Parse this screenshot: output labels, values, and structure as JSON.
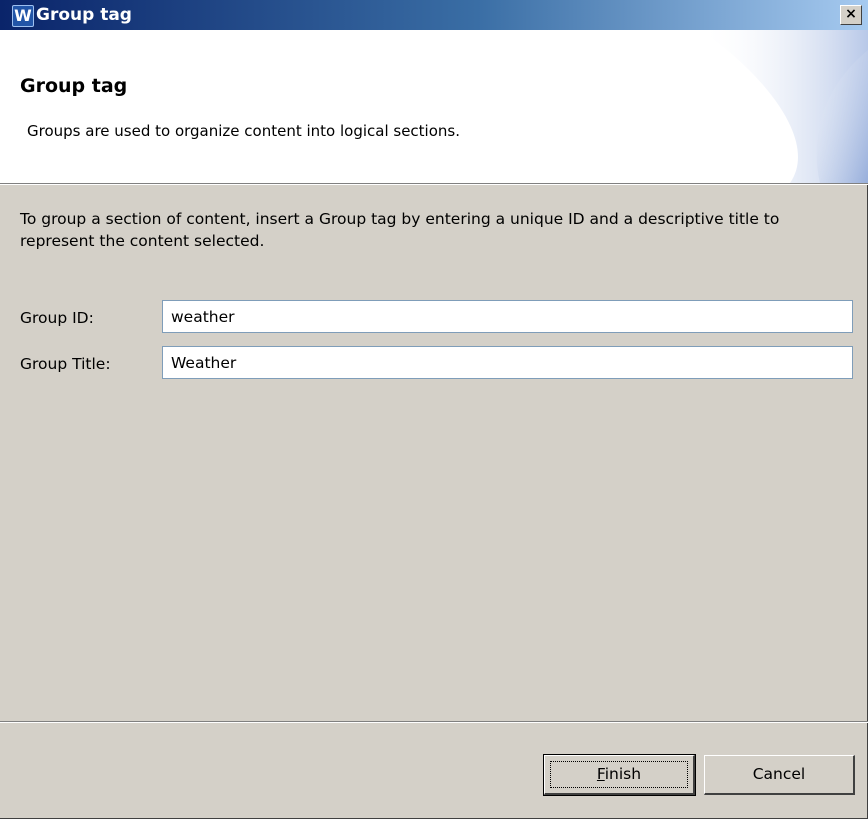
{
  "window": {
    "title": "Group tag",
    "app_icon_glyph": "W",
    "app_icon_name": "app-icon",
    "close_glyph": "×"
  },
  "header": {
    "title": "Group tag",
    "description": "Groups are used to organize content into logical sections."
  },
  "body": {
    "instructions": "To group a section of content, insert a Group tag by entering a unique ID and a descriptive title to represent the content selected.",
    "group_id": {
      "label": "Group ID:",
      "value": "weather"
    },
    "group_title": {
      "label": "Group Title:",
      "value": "Weather"
    }
  },
  "buttons": {
    "finish": {
      "mnemonic": "F",
      "rest": "inish"
    },
    "cancel": "Cancel"
  },
  "colors": {
    "titlebar_start": "#0a246a",
    "titlebar_end": "#a6caf0",
    "dialog_background": "#d4d0c8"
  }
}
